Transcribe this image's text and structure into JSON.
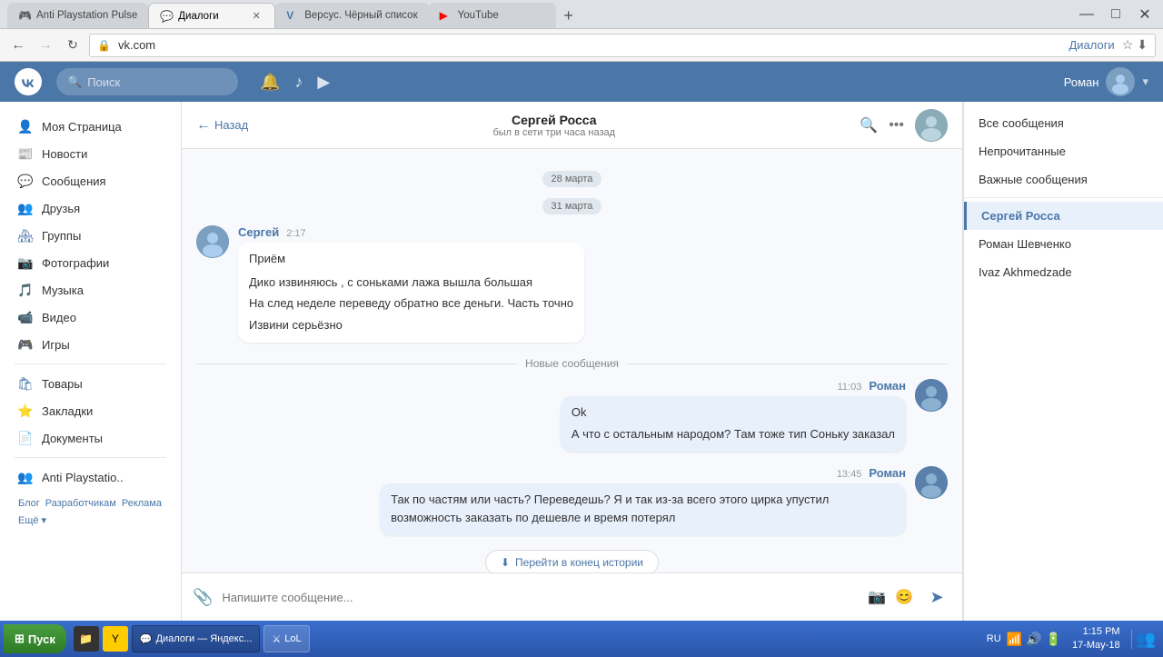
{
  "browser": {
    "tabs": [
      {
        "id": "tab1",
        "title": "Anti Playstation Pulse",
        "favicon": "🎮",
        "active": false
      },
      {
        "id": "tab2",
        "title": "Диалоги",
        "favicon": "💬",
        "active": true
      },
      {
        "id": "tab3",
        "title": "Версус. Чёрный список",
        "favicon": "V",
        "active": false
      },
      {
        "id": "tab4",
        "title": "YouTube",
        "favicon": "▶",
        "active": false
      }
    ],
    "address": {
      "domain": "vk.com",
      "path": "Диалоги"
    }
  },
  "vk": {
    "header": {
      "logo": "ВК",
      "search_placeholder": "Поиск",
      "user": "Роман"
    },
    "sidebar": {
      "items": [
        {
          "label": "Моя Страница",
          "icon": "👤"
        },
        {
          "label": "Новости",
          "icon": "📰"
        },
        {
          "label": "Сообщения",
          "icon": "💬"
        },
        {
          "label": "Друзья",
          "icon": "👥"
        },
        {
          "label": "Группы",
          "icon": "🏘"
        },
        {
          "label": "Фотографии",
          "icon": "📷"
        },
        {
          "label": "Музыка",
          "icon": "🎵"
        },
        {
          "label": "Видео",
          "icon": "📹"
        },
        {
          "label": "Игры",
          "icon": "🎮"
        },
        {
          "label": "Товары",
          "icon": "🛍"
        },
        {
          "label": "Закладки",
          "icon": "⭐"
        },
        {
          "label": "Документы",
          "icon": "📄"
        },
        {
          "label": "Anti Playstatio..",
          "icon": "👥"
        }
      ],
      "footer": [
        "Блог",
        "Разработчикам",
        "Реклама",
        "Ещё ▾"
      ]
    },
    "chat": {
      "header": {
        "back_label": "Назад",
        "username": "Сергей Росса",
        "status": "был в сети три часа назад"
      },
      "dates": {
        "date1": "28 марта",
        "date2": "31 марта"
      },
      "messages": [
        {
          "id": "m1",
          "sender": "Сергей",
          "time": "2:17",
          "own": false,
          "lines": [
            "Приём",
            "",
            "Дико извиняюсь , с соньками лажа вышла большая",
            "",
            "На след неделе переведу обратно все деньги. Часть точно",
            "",
            "Извини серьёзно"
          ]
        },
        {
          "id": "m2",
          "sender": "Роман",
          "time": "11:03",
          "own": true,
          "lines": [
            "Ok",
            "",
            "А что с остальным народом? Там тоже тип Соньку заказал"
          ]
        },
        {
          "id": "m3",
          "sender": "Роман",
          "time": "13:45",
          "own": true,
          "lines": [
            "Так по частям или часть? Переведешь? Я и так из-за всего этого цирка упустил возможность заказать по дешевле и время потерял"
          ]
        }
      ],
      "new_messages_label": "Новые сообщения",
      "scroll_to_end": "Перейти в конец истории",
      "input_placeholder": "Напишите сообщение..."
    },
    "messages_panel": {
      "sections": [
        {
          "label": "Все сообщения",
          "active": false
        },
        {
          "label": "Непрочитанные",
          "active": false
        },
        {
          "label": "Важные сообщения",
          "active": false
        }
      ],
      "contacts": [
        {
          "name": "Сергей Росса",
          "active": true
        },
        {
          "name": "Роман Шевченко",
          "active": false
        },
        {
          "name": "Ivaz Akhmedzade",
          "active": false
        }
      ]
    }
  },
  "taskbar": {
    "start_label": "Пуск",
    "buttons": [
      {
        "label": "Диалоги — Яндекс...",
        "active": true
      },
      {
        "label": "LoL",
        "active": false
      }
    ],
    "clock": {
      "time": "1:15 PM",
      "date": "17-May-18"
    },
    "lang": "RU"
  }
}
